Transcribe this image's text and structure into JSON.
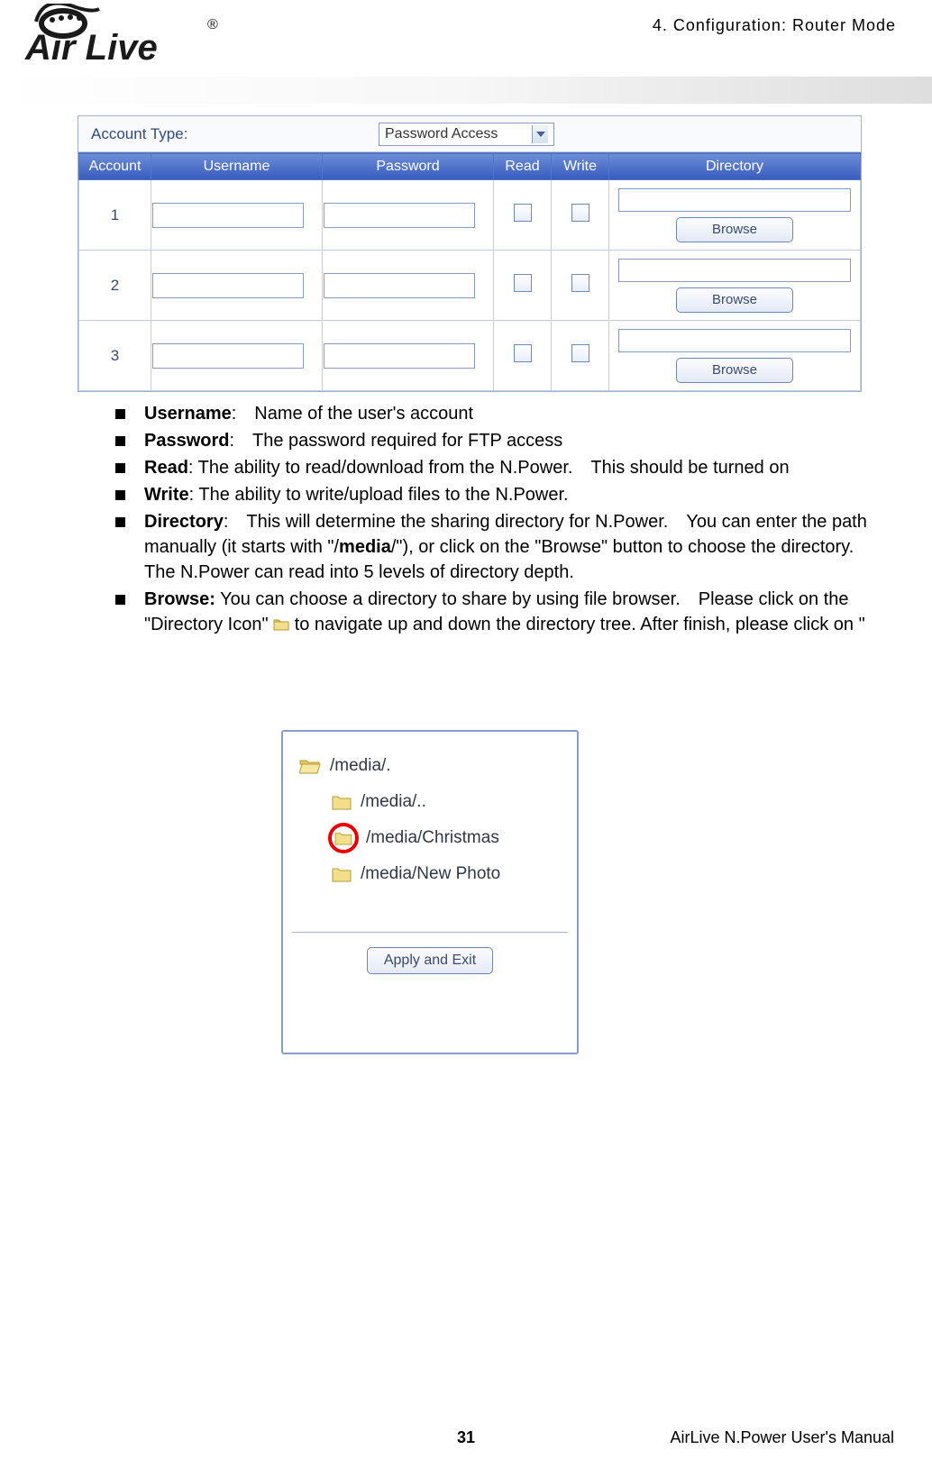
{
  "header": {
    "chapter": "4. Configuration: Router Mode",
    "logo_text": "Air Live"
  },
  "panel": {
    "account_type_label": "Account Type:",
    "account_type_value": "Password Access",
    "columns": {
      "account": "Account",
      "username": "Username",
      "password": "Password",
      "read": "Read",
      "write": "Write",
      "directory": "Directory"
    },
    "rows": [
      "1",
      "2",
      "3"
    ],
    "browse_btn": "Browse"
  },
  "bullets": {
    "username_label": "Username",
    "username_text": ": Name of the user's account",
    "password_label": "Password",
    "password_text": ": The password required for FTP access",
    "read_label": "Read",
    "read_text": ": The ability to read/download from the N.Power. This should be turned on",
    "write_label": "Write",
    "write_text": ": The ability to write/upload files to the N.Power.",
    "directory_label": "Directory",
    "directory_text_a": ": This will determine the sharing directory for N.Power. You can enter the path manually (it starts with \"/",
    "directory_media": "media",
    "directory_text_b": "/\"), or click on the \"Browse\" button to choose the directory. The N.Power can read into 5 levels of directory depth.",
    "browse_label": "Browse:",
    "browse_text_a": " You can choose a directory to share by using file browser. Please click on the \"Directory Icon\" ",
    "browse_text_b": " to navigate up and down the directory tree. After finish, please click on \""
  },
  "browser": {
    "items": [
      "/media/.",
      "/media/..",
      "/media/Christmas",
      "/media/New Photo"
    ],
    "apply_btn": "Apply and Exit"
  },
  "footer": {
    "page": "31",
    "right": "AirLive N.Power User's Manual"
  }
}
